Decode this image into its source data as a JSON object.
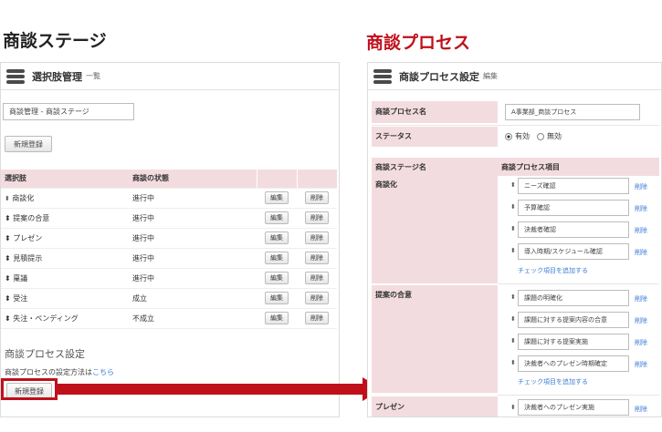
{
  "left": {
    "heading": "商談ステージ",
    "panel_title": "選択肢管理",
    "panel_sub": "一覧",
    "breadcrumb": "商談管理 - 商談ステージ",
    "new_button": "新規登録",
    "table": {
      "headers": [
        "選択肢",
        "商談の状態",
        "",
        ""
      ],
      "rows": [
        {
          "name": "商談化",
          "state": "進行中",
          "edit": "編集",
          "delete": "削除"
        },
        {
          "name": "提案の合意",
          "state": "進行中",
          "edit": "編集",
          "delete": "削除"
        },
        {
          "name": "プレゼン",
          "state": "進行中",
          "edit": "編集",
          "delete": "削除"
        },
        {
          "name": "見積提示",
          "state": "進行中",
          "edit": "編集",
          "delete": "削除"
        },
        {
          "name": "稟議",
          "state": "進行中",
          "edit": "編集",
          "delete": "削除"
        },
        {
          "name": "受注",
          "state": "成立",
          "edit": "編集",
          "delete": "削除"
        },
        {
          "name": "失注・ペンディング",
          "state": "不成立",
          "edit": "編集",
          "delete": "削除"
        }
      ]
    },
    "process_section_title": "商談プロセス設定",
    "process_text": "商談プロセスの設定方法は",
    "process_link": "こちら",
    "process_new_button": "新規登録"
  },
  "right": {
    "heading": "商談プロセス",
    "panel_title": "商談プロセス設定",
    "panel_sub": "編集",
    "name_label": "商談プロセス名",
    "name_value": "A事業部_商談プロセス",
    "status_label": "ステータス",
    "status_options": [
      "有効",
      "無効"
    ],
    "stage_col": "商談ステージ名",
    "item_col": "商談プロセス項目",
    "delete_label": "削除",
    "add_link": "チェック項目を追加する",
    "groups": [
      {
        "stage": "商談化",
        "items": [
          "ニーズ確認",
          "予算確認",
          "決裁者確認",
          "導入時期/スケジュール確認"
        ]
      },
      {
        "stage": "提案の合意",
        "items": [
          "課題の明確化",
          "課題に対する提案内容の合意",
          "課題に対する提案実施",
          "決裁者へのプレゼン時期確定"
        ]
      },
      {
        "stage": "プレゼン",
        "items": [
          "決裁者へのプレゼン実施"
        ]
      }
    ]
  },
  "colors": {
    "accent_red": "#c0101b",
    "header_pink": "#f3dcdf",
    "link_blue": "#3b7bd4"
  }
}
